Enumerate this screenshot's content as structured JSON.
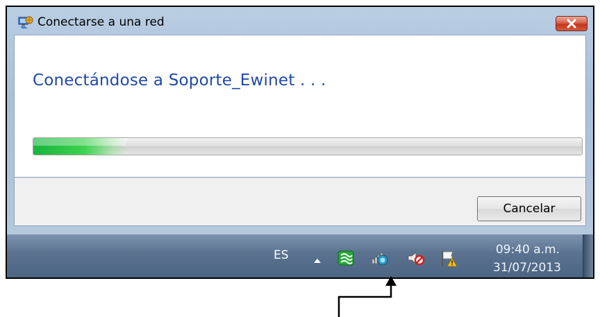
{
  "window": {
    "title": "Conectarse a una red",
    "title_icon": "network-globe-icon",
    "close_icon": "close-icon"
  },
  "dialog": {
    "heading": "Conectándose a Soporte_Ewinet . . .",
    "progress_fraction": 0.17,
    "progress_color": "#3ed24f",
    "cancel_label": "Cancelar"
  },
  "taskbar": {
    "language": "ES",
    "tray_icons": [
      "show-hidden-arrow-icon",
      "green-app-icon",
      "network-connecting-icon",
      "volume-muted-icon",
      "action-center-flag-icon"
    ],
    "time": "09:40 a.m.",
    "date": "31/07/2013"
  },
  "colors": {
    "heading": "#1f49a8",
    "close_button": "#c4341c",
    "taskbar": "#5b7390"
  }
}
